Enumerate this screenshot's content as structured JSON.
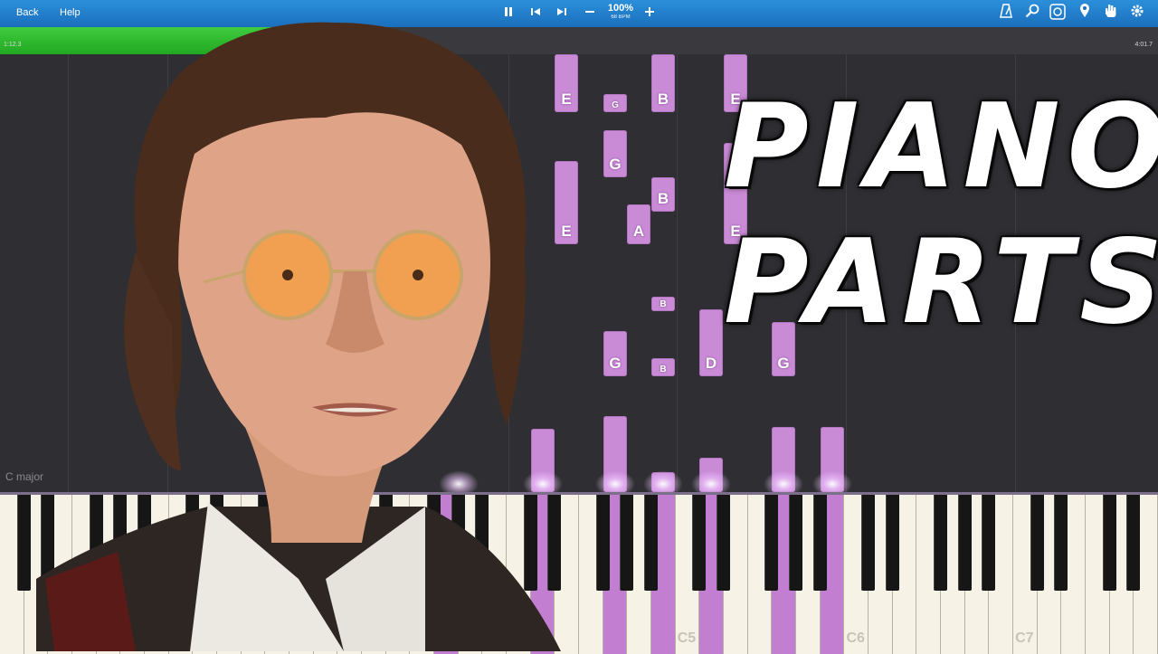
{
  "toolbar": {
    "back_label": "Back",
    "help_label": "Help",
    "pause_icon": "pause-icon",
    "prev_icon": "skip-back-icon",
    "next_icon": "skip-forward-icon",
    "minus_icon": "minus-icon",
    "plus_icon": "plus-icon",
    "speed_percent": "100%",
    "speed_bpm": "68 BPM",
    "right_icons": [
      "metronome-icon",
      "zoom-icon",
      "visual-settings-icon",
      "camera-icon",
      "location-pin-icon",
      "hand-icon",
      "gear-icon"
    ]
  },
  "progress": {
    "elapsed": "1:12.3",
    "total": "4:01.7",
    "fraction": 0.31
  },
  "key_signature": "C major",
  "octave_labels": [
    "C5",
    "C6",
    "C7"
  ],
  "notes": [
    {
      "label": "E"
    },
    {
      "label": "G"
    },
    {
      "label": "B"
    },
    {
      "label": "E"
    },
    {
      "label": "G"
    },
    {
      "label": "B"
    },
    {
      "label": "E"
    },
    {
      "label": "A"
    },
    {
      "label": "E"
    },
    {
      "label": "B"
    },
    {
      "label": "G"
    },
    {
      "label": "B"
    },
    {
      "label": "D"
    },
    {
      "label": "G"
    }
  ],
  "title": {
    "line1": "PIANO",
    "line2": "PARTS"
  },
  "colors": {
    "note": "#c98ad6",
    "toolbar": "#1a7fd0",
    "progress": "#2fbf2f",
    "background": "#2f2f33"
  }
}
